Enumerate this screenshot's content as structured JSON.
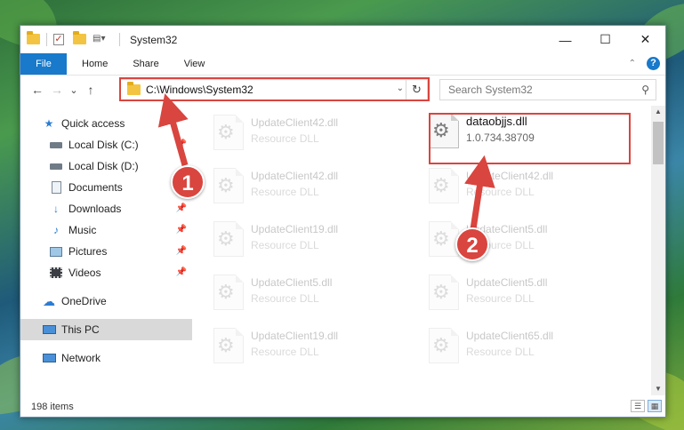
{
  "window": {
    "title": "System32",
    "controls": {
      "minimize": "—",
      "maximize": "☐",
      "close": "✕"
    }
  },
  "ribbon": {
    "tabs": [
      {
        "label": "File"
      },
      {
        "label": "Home"
      },
      {
        "label": "Share"
      },
      {
        "label": "View"
      }
    ],
    "collapse": "⌃",
    "help": "?"
  },
  "nav": {
    "back": "←",
    "forward": "→",
    "recent": "⌄",
    "up": "↑"
  },
  "address": {
    "path": "C:\\Windows\\System32",
    "dropdown": "⌄",
    "refresh": "↻"
  },
  "search": {
    "placeholder": "Search System32",
    "icon": "search-icon"
  },
  "sidebar": {
    "items": [
      {
        "label": "Quick access",
        "icon": "star-icon"
      },
      {
        "label": "Local Disk (C:)",
        "icon": "drive-icon"
      },
      {
        "label": "Local Disk (D:)",
        "icon": "drive-icon"
      },
      {
        "label": "Documents",
        "icon": "documents-icon"
      },
      {
        "label": "Downloads",
        "icon": "download-icon"
      },
      {
        "label": "Music",
        "icon": "music-icon"
      },
      {
        "label": "Pictures",
        "icon": "pictures-icon"
      },
      {
        "label": "Videos",
        "icon": "videos-icon"
      },
      {
        "label": "OneDrive",
        "icon": "cloud-icon"
      },
      {
        "label": "This PC",
        "icon": "computer-icon"
      },
      {
        "label": "Network",
        "icon": "network-icon"
      }
    ]
  },
  "files": {
    "left": [
      {
        "name": "UpdateClient42.dll",
        "desc": "Resource DLL"
      },
      {
        "name": "UpdateClient42.dll",
        "desc": "Resource DLL"
      },
      {
        "name": "UpdateClient19.dll",
        "desc": "Resource DLL"
      },
      {
        "name": "UpdateClient5.dll",
        "desc": "Resource DLL"
      },
      {
        "name": "UpdateClient19.dll",
        "desc": "Resource DLL"
      }
    ],
    "focus": {
      "name": "dataobjjs.dll",
      "desc": "1.0.734.38709"
    },
    "right": [
      {
        "name": "UpdateClient42.dll",
        "desc": "Resource DLL"
      },
      {
        "name": "UpdateClient5.dll",
        "desc": "Resource DLL"
      },
      {
        "name": "UpdateClient5.dll",
        "desc": "Resource DLL"
      },
      {
        "name": "UpdateClient65.dll",
        "desc": "Resource DLL"
      }
    ]
  },
  "status": {
    "count": "198 items"
  },
  "markers": {
    "first": "1",
    "second": "2"
  },
  "colors": {
    "accent": "#1979ca",
    "highlight": "#d9453f"
  }
}
